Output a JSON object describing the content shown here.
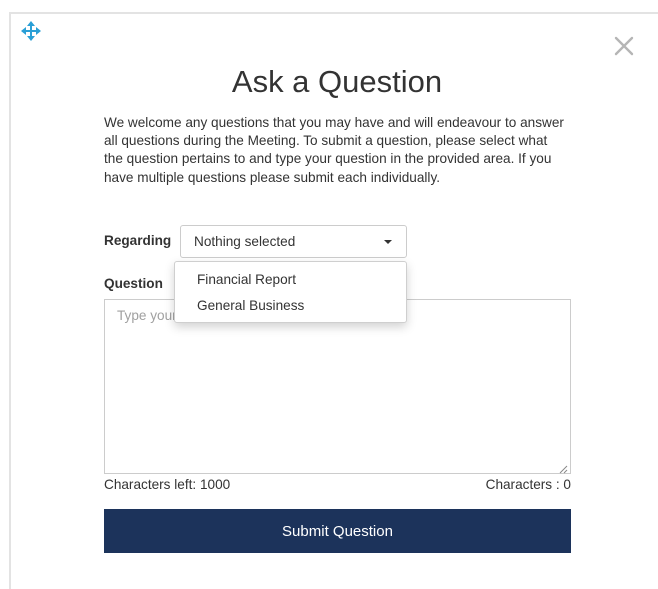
{
  "modal": {
    "title": "Ask a Question",
    "intro": "We welcome any questions that you may have and will endeavour to answer all questions during the Meeting. To submit a question, please select what the question pertains to and type your question in the provided area. If you have multiple questions please submit each individually.",
    "close_icon": "close-icon",
    "move_icon": "move-icon"
  },
  "form": {
    "regarding_label": "Regarding",
    "select_value": "Nothing selected",
    "options": [
      "Financial Report",
      "General Business"
    ],
    "question_label": "Question",
    "textarea_placeholder": "Type your question here",
    "chars_left": "Characters left: 1000",
    "chars_count": "Characters : 0",
    "submit_label": "Submit Question"
  },
  "colors": {
    "submit_bg": "#1c335b",
    "move_icon": "#2a9fd6",
    "close_icon": "#b5b5b5"
  }
}
